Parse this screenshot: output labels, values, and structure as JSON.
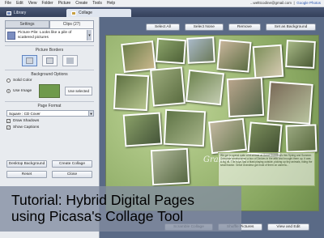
{
  "menu": {
    "items": [
      "File",
      "Edit",
      "View",
      "Folder",
      "Picture",
      "Create",
      "Tools",
      "Help"
    ],
    "account": "...welttcodine@gmail.com",
    "app_link": "Google Photos"
  },
  "tabs": [
    {
      "label": "Library"
    },
    {
      "label": "Collage"
    }
  ],
  "left_panel": {
    "subtabs": [
      "Settings",
      "Clips (27)"
    ],
    "layout": {
      "label": "Picture Pile: Looks like a pile of scattered pictures"
    },
    "picture_borders_label": "Picture Borders",
    "background_options_label": "Background Options",
    "solid_color_label": "Solid Color",
    "use_image_label": "Use Image",
    "use_selected_label": "Use selected",
    "page_format_label": "Page Format",
    "page_format_value": "Square : CD Cover",
    "draw_shadows_label": "Draw Shadows",
    "show_captions_label": "Show Captions",
    "desktop_background_label": "Desktop Background",
    "create_collage_label": "Create Collage",
    "reset_label": "Reset",
    "close_label": "Close"
  },
  "toolbar": {
    "select_all": "Select All",
    "select_none": "Select None",
    "remove": "Remove",
    "set_as_background": "Set as Background"
  },
  "bottom_buttons": {
    "add_caption": "Scramble Collage",
    "shuffle": "Shuffle Pictures",
    "view_and_edit": "View and Edit"
  },
  "canvas": {
    "overlay_title": "Grandkids",
    "note_text": "We got to spend quite a lot of time at Great Grandma's this Spring and Summer. Grandma remembered a box of Dinkies in the attic and brought them up. It was a big hit. The boys had a blast playing outside, picking up tiny animals, riding the small tractor. Great Grandma got most of them on camera..."
  },
  "banner": {
    "line1": "Tutorial: Hybrid Digital Pages",
    "line2": "using Picasa's Collage Tool"
  },
  "colors": {
    "tab_bar": "#3f4b66",
    "canvas_green": "#a8c07c",
    "banner_bg": "#8a94a8"
  }
}
